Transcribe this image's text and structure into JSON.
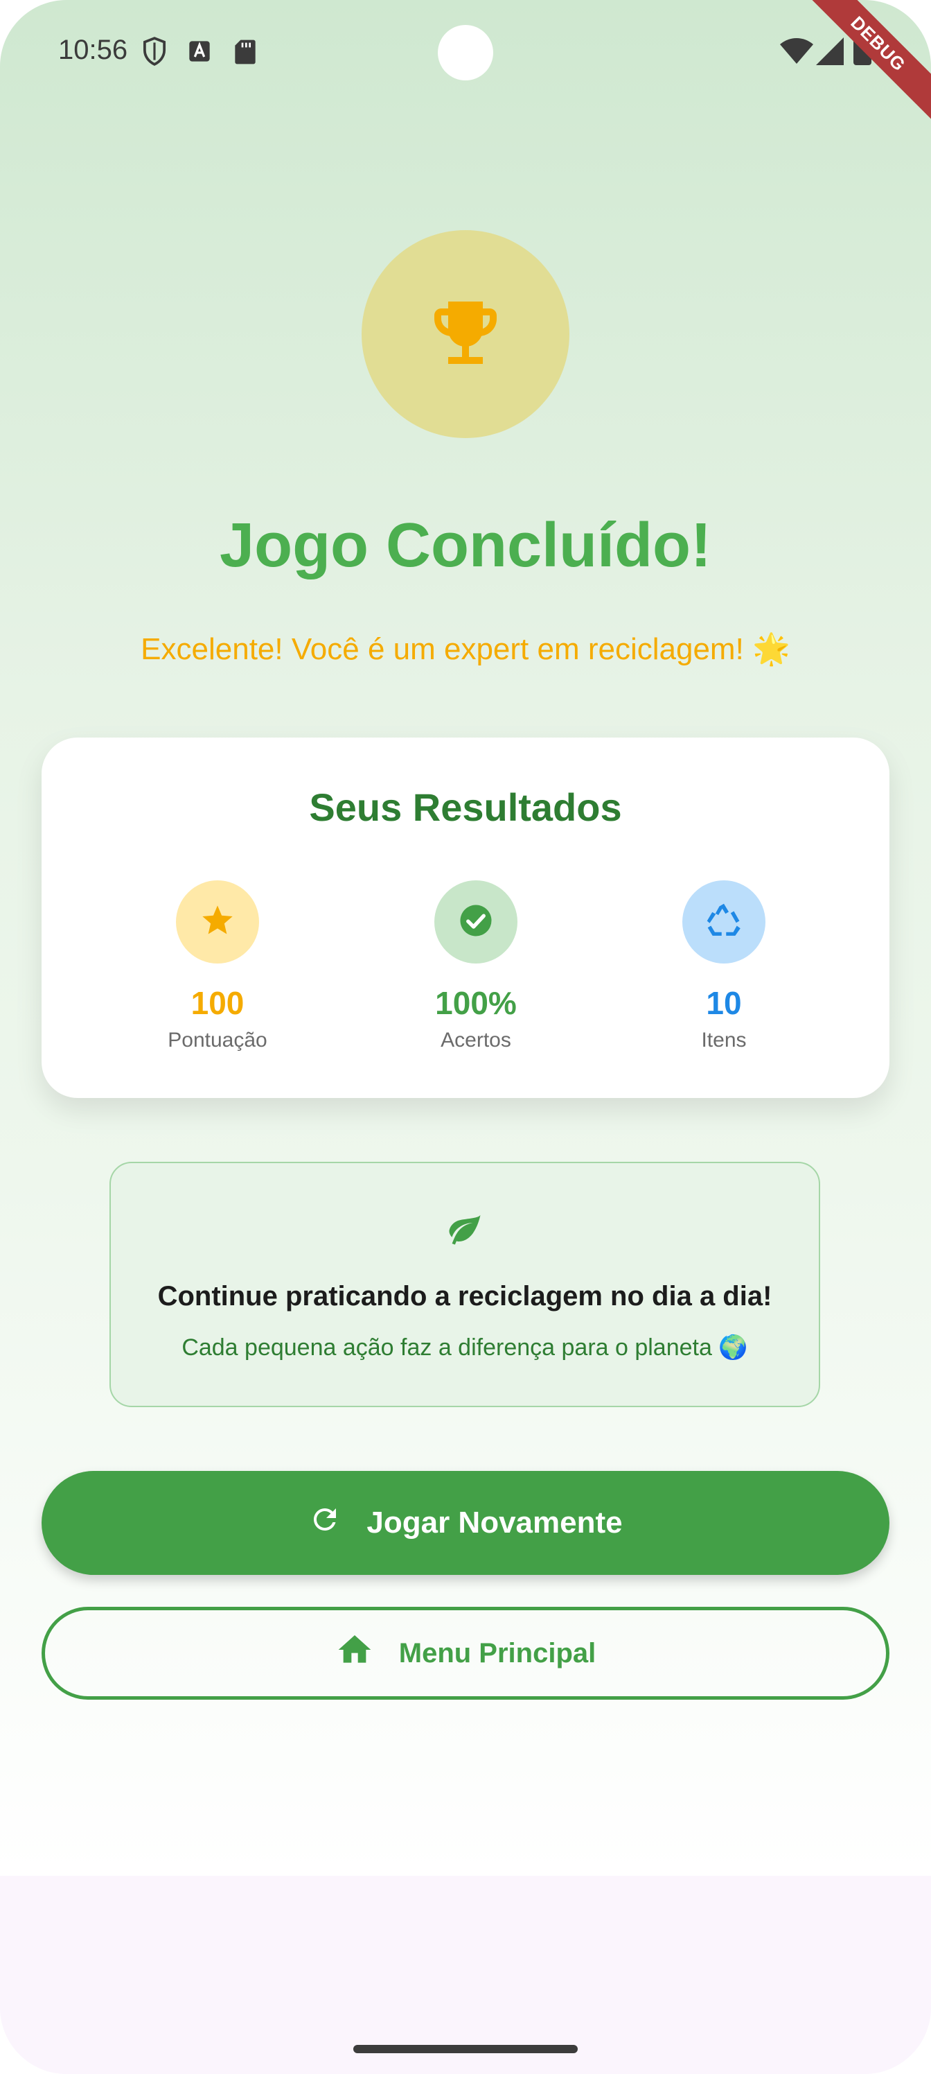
{
  "status_bar": {
    "time": "10:56",
    "debug_banner": "DEBUG",
    "left_icons": [
      "shield-icon",
      "font-a-icon",
      "sd-card-icon"
    ],
    "right_icons": [
      "wifi-icon",
      "signal-icon",
      "battery-icon"
    ]
  },
  "header": {
    "icon": "trophy-icon",
    "title": "Jogo Concluído!",
    "subtitle": "Excelente! Você é um expert em reciclagem! 🌟"
  },
  "results": {
    "title": "Seus Resultados",
    "stats": [
      {
        "icon": "star-icon",
        "value": "100",
        "label": "Pontuação",
        "color": "#f5ab00",
        "bg": "#ffe9a8"
      },
      {
        "icon": "check-circle-icon",
        "value": "100%",
        "label": "Acertos",
        "color": "#43a047",
        "bg": "#c8e6c9"
      },
      {
        "icon": "recycle-icon",
        "value": "10",
        "label": "Itens",
        "color": "#1e88e5",
        "bg": "#bbdefb"
      }
    ]
  },
  "tip": {
    "icon": "leaf-icon",
    "title": "Continue praticando a reciclagem no dia a dia!",
    "subtitle": "Cada pequena ação faz a diferença para o planeta 🌍"
  },
  "actions": {
    "play_again": {
      "label": "Jogar Novamente",
      "icon": "refresh-icon"
    },
    "main_menu": {
      "label": "Menu Principal",
      "icon": "home-icon"
    }
  },
  "colors": {
    "primary_green": "#43a047",
    "title_green": "#4caf50",
    "accent_amber": "#f5ab00"
  }
}
